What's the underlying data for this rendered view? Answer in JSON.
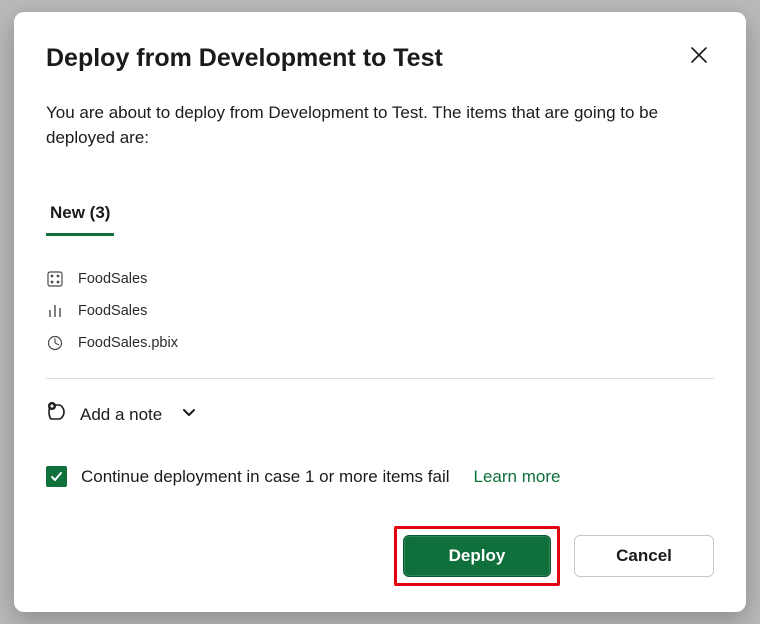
{
  "dialog": {
    "title": "Deploy from Development to Test",
    "description": "You are about to deploy from Development to Test. The items that are going to be deployed are:",
    "tab_label": "New (3)",
    "items": [
      {
        "icon": "semantic-model-icon",
        "name": "FoodSales"
      },
      {
        "icon": "report-icon",
        "name": "FoodSales"
      },
      {
        "icon": "dashboard-icon",
        "name": "FoodSales.pbix"
      }
    ],
    "add_note_label": "Add a note",
    "continue_on_fail_label": "Continue deployment in case 1 or more items fail",
    "continue_on_fail_checked": true,
    "learn_more_label": "Learn more",
    "deploy_button": "Deploy",
    "cancel_button": "Cancel"
  }
}
